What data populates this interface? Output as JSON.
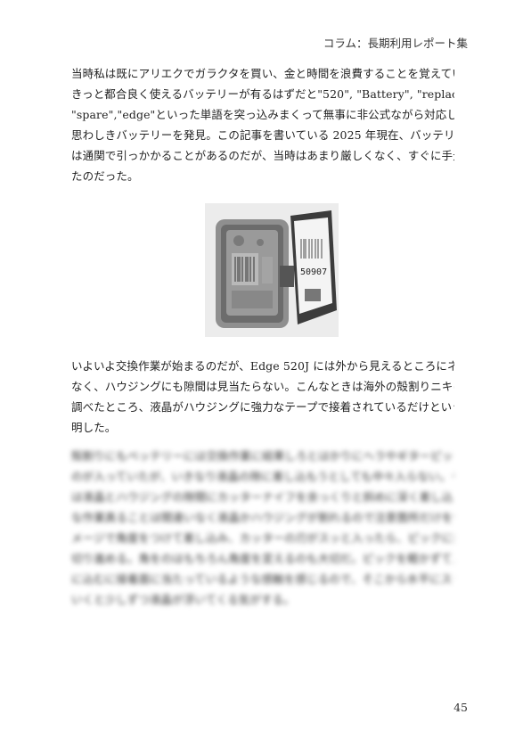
{
  "running_head": "コラム：長期利用レポート集",
  "paragraph1": [
    "当時私は既にアリエクでガラクタを買い、金と時間を浪費することを覚えていたので",
    "きっと都合良く使えるバッテリーが有るはずだと\"520\", \"Battery\", \"replacement\",",
    "\"spare\",\"edge\"といった単語を突っ込みまくって無事に非公式ながら対応していると",
    "思わしきバッテリーを発見。この記事を書いている 2025 年現在、バッテリー関連製品",
    "は通関で引っかかることがあるのだが、当時はあまり厳しくなく、すぐに手元に到着し",
    "たのだった。"
  ],
  "photo_barcode_text": "50907",
  "paragraph2": [
    "いよいよ交換作業が始まるのだが、Edge 520J には外から見えるところにネジなどは",
    "なく、ハウジングにも隙間は見当たらない。こんなときは海外の殻割りニキに頼ろうと",
    "調べたところ、液晶がハウジングに強力なテープで接着されているだけということが判",
    "明した。"
  ],
  "paragraph3_blurred": [
    "殻割りにもベッテリーには交換作業に結果しろとはかりにヘラやギターピックのようなも",
    "のが入っていたが、いきなり液晶の隙に差し込もうとしても中々入らない。そこでまず",
    "は液晶とハウジングの隙間にカッターナイフを余っくりと斜めに深く差し込ませた。結局",
    "な作業真ることは間違いなく液晶かハウジングが割れるので注意箇所だけを切るようなイ",
    "メージで角度をつけて差し込み、カッターの刃がスッと入ったら、ピックに持ち替えて1辺ずつ",
    "切り進める。角をのはもちろん角度を変えるのも大切だ。ピックを軽かずてスッと隙間液",
    "に込むに接着面に当たっているような感触を感じるので、そこから水平にスライドさせて",
    "いくと少しずつ液晶が浮いてくる気がする。"
  ],
  "page_number": "45"
}
